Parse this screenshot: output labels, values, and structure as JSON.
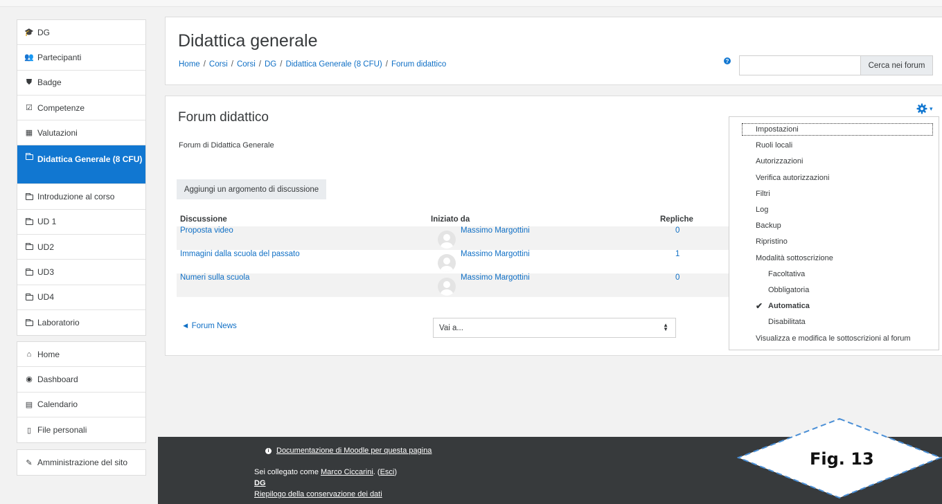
{
  "sidebar": {
    "course_items": [
      {
        "label": "DG",
        "icon": "graduation-cap-icon"
      },
      {
        "label": "Partecipanti",
        "icon": "users-icon"
      },
      {
        "label": "Badge",
        "icon": "shield-icon"
      },
      {
        "label": "Competenze",
        "icon": "check-square-icon"
      },
      {
        "label": "Valutazioni",
        "icon": "table-icon"
      },
      {
        "label": "Didattica Generale (8 CFU)",
        "icon": "folder-icon",
        "active": true
      },
      {
        "label": "Introduzione al corso",
        "icon": "folder-icon"
      },
      {
        "label": "UD 1",
        "icon": "folder-icon"
      },
      {
        "label": "UD2",
        "icon": "folder-icon"
      },
      {
        "label": "UD3",
        "icon": "folder-icon"
      },
      {
        "label": "UD4",
        "icon": "folder-icon"
      },
      {
        "label": "Laboratorio",
        "icon": "folder-icon"
      }
    ],
    "site_items": [
      {
        "label": "Home",
        "icon": "home-icon"
      },
      {
        "label": "Dashboard",
        "icon": "dashboard-icon"
      },
      {
        "label": "Calendario",
        "icon": "calendar-icon"
      },
      {
        "label": "File personali",
        "icon": "file-icon"
      }
    ],
    "admin_item": {
      "label": "Amministrazione del sito",
      "icon": "wrench-icon"
    }
  },
  "header": {
    "title": "Didattica generale",
    "breadcrumb": [
      "Home",
      "Corsi",
      "Corsi",
      "DG",
      "Didattica Generale (8 CFU)",
      "Forum didattico"
    ],
    "breadcrumb_separator": "/",
    "search_placeholder": "",
    "search_button": "Cerca nei forum"
  },
  "forum": {
    "title": "Forum didattico",
    "intro": "Forum di Didattica Generale",
    "add_topic_button": "Aggiungi un argomento di discussione",
    "columns": {
      "discussion": "Discussione",
      "started_by": "Iniziato da",
      "replies": "Repliche"
    },
    "discussions": [
      {
        "topic": "Proposta video",
        "author": "Massimo Margottini",
        "replies": "0"
      },
      {
        "topic": "Immagini dalla scuola del passato",
        "author": "Massimo Margottini",
        "replies": "1"
      },
      {
        "topic": "Numeri sulla scuola",
        "author": "Massimo Margottini",
        "replies": "0"
      }
    ],
    "prev_link": "◄ Forum News",
    "jump_select_value": "Vai a..."
  },
  "settings_menu": {
    "items": [
      {
        "label": "Impostazioni",
        "focused": true
      },
      {
        "label": "Ruoli locali"
      },
      {
        "label": "Autorizzazioni"
      },
      {
        "label": "Verifica autorizzazioni"
      },
      {
        "label": "Filtri"
      },
      {
        "label": "Log"
      },
      {
        "label": "Backup"
      },
      {
        "label": "Ripristino"
      },
      {
        "label": "Modalità sottoscrizione"
      },
      {
        "label": "Facoltativa",
        "sub": true
      },
      {
        "label": "Obbligatoria",
        "sub": true
      },
      {
        "label": "Automatica",
        "sub": true,
        "checked": true
      },
      {
        "label": "Disabilitata",
        "sub": true
      },
      {
        "label": "Visualizza e modifica le sottoscrizioni al forum"
      }
    ]
  },
  "footer": {
    "doc_link": "Documentazione di Moodle per questa pagina",
    "logged_in_prefix": "Sei collegato come ",
    "user_name": "Marco Ciccarini",
    "logout_link": "Esci",
    "dg_link": "DG",
    "data_link": "Riepilogo della conservazione dei dati"
  },
  "figure_label": "Fig. 13",
  "colors": {
    "accent": "#1177d1",
    "link": "#0f6fc5",
    "footer_bg": "#373a3c"
  }
}
